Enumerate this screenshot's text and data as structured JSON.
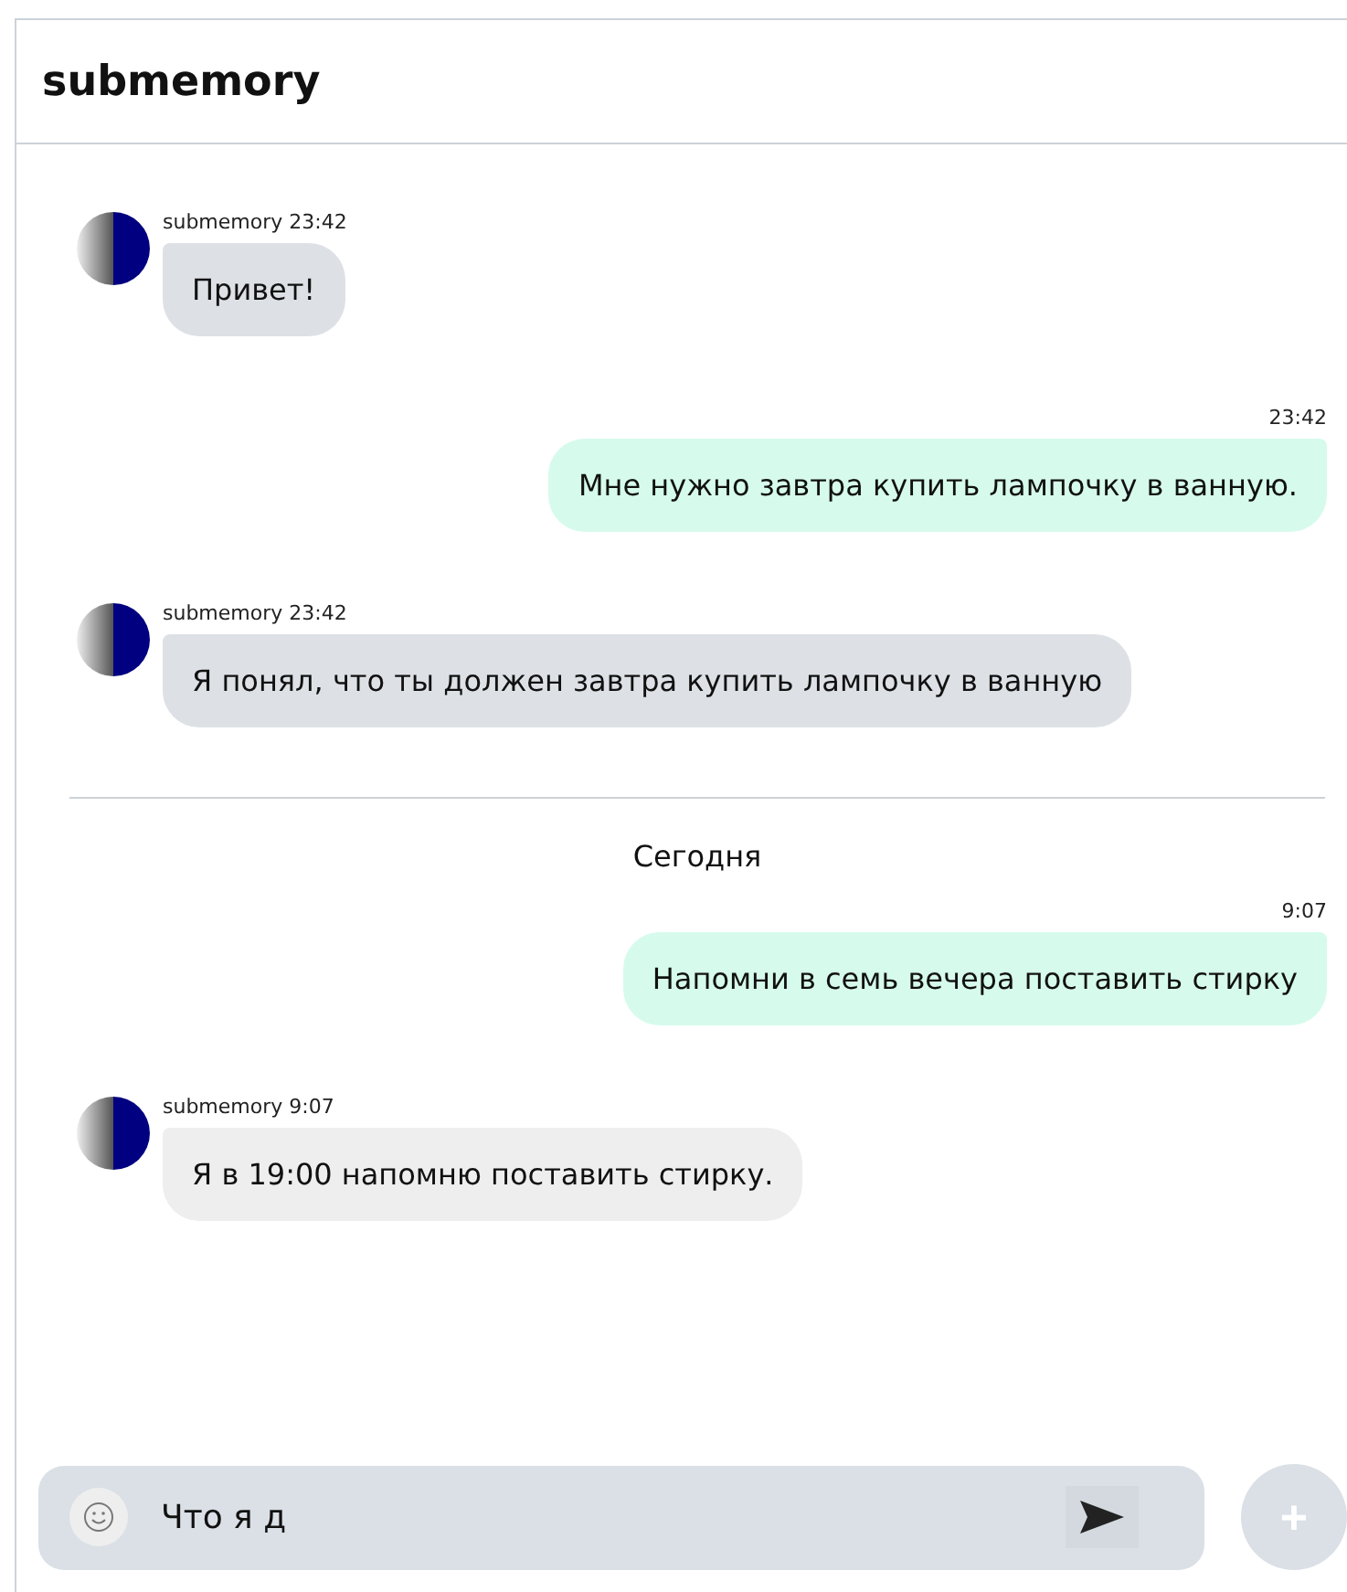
{
  "header": {
    "title": "submemory"
  },
  "messages": [
    {
      "kind": "incoming",
      "author": "submemory",
      "time": "23:42",
      "text": "Привет!"
    },
    {
      "kind": "outgoing",
      "time": "23:42",
      "text": "Мне нужно завтра купить лампочку в ванную."
    },
    {
      "kind": "incoming",
      "author": "submemory",
      "time": "23:42",
      "text": "Я понял, что ты должен завтра купить лампочку в ванную"
    },
    {
      "kind": "divider",
      "text": "Сегодня"
    },
    {
      "kind": "outgoing",
      "time": "9:07",
      "text": "Напомни в семь вечера поставить стирку"
    },
    {
      "kind": "incoming",
      "author": "submemory",
      "time": "9:07",
      "text": "Я в 19:00 напомню поставить стирку."
    }
  ],
  "composer": {
    "value": "Что я д",
    "add_button": "+"
  }
}
